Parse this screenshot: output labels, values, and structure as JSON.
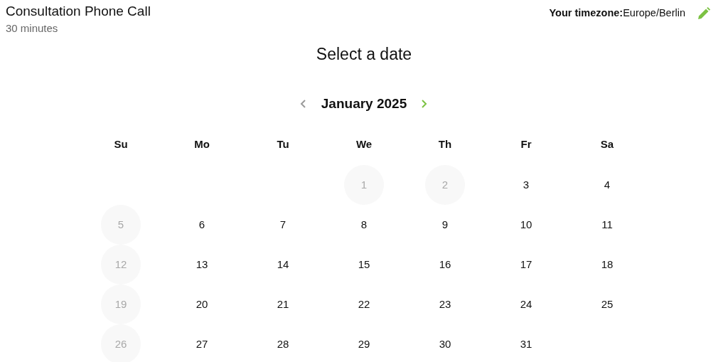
{
  "event": {
    "title": "Consultation Phone Call",
    "duration": "30 minutes"
  },
  "timezone": {
    "label": "Your timezone:",
    "value": "Europe/Berlin"
  },
  "heading": "Select a date",
  "month_nav": {
    "month": "January 2025",
    "prev_disabled": true,
    "next_disabled": false
  },
  "weekdays": [
    "Su",
    "Mo",
    "Tu",
    "We",
    "Th",
    "Fr",
    "Sa"
  ],
  "weeks": [
    {
      "days": [
        {
          "blank": true
        },
        {
          "blank": true
        },
        {
          "blank": true
        },
        {
          "day": "1",
          "disabled": true
        },
        {
          "day": "2",
          "disabled": true
        },
        {
          "day": "3",
          "disabled": false
        },
        {
          "day": "4",
          "disabled": false
        }
      ]
    },
    {
      "days": [
        {
          "day": "5",
          "disabled": true
        },
        {
          "day": "6",
          "disabled": false
        },
        {
          "day": "7",
          "disabled": false
        },
        {
          "day": "8",
          "disabled": false
        },
        {
          "day": "9",
          "disabled": false
        },
        {
          "day": "10",
          "disabled": false
        },
        {
          "day": "11",
          "disabled": false
        }
      ]
    },
    {
      "days": [
        {
          "day": "12",
          "disabled": true
        },
        {
          "day": "13",
          "disabled": false
        },
        {
          "day": "14",
          "disabled": false
        },
        {
          "day": "15",
          "disabled": false
        },
        {
          "day": "16",
          "disabled": false
        },
        {
          "day": "17",
          "disabled": false
        },
        {
          "day": "18",
          "disabled": false
        }
      ]
    },
    {
      "days": [
        {
          "day": "19",
          "disabled": true
        },
        {
          "day": "20",
          "disabled": false
        },
        {
          "day": "21",
          "disabled": false
        },
        {
          "day": "22",
          "disabled": false
        },
        {
          "day": "23",
          "disabled": false
        },
        {
          "day": "24",
          "disabled": false
        },
        {
          "day": "25",
          "disabled": false
        }
      ]
    },
    {
      "days": [
        {
          "day": "26",
          "disabled": true
        },
        {
          "day": "27",
          "disabled": false
        },
        {
          "day": "28",
          "disabled": false
        },
        {
          "day": "29",
          "disabled": false
        },
        {
          "day": "30",
          "disabled": false
        },
        {
          "day": "31",
          "disabled": false
        }
      ]
    }
  ]
}
